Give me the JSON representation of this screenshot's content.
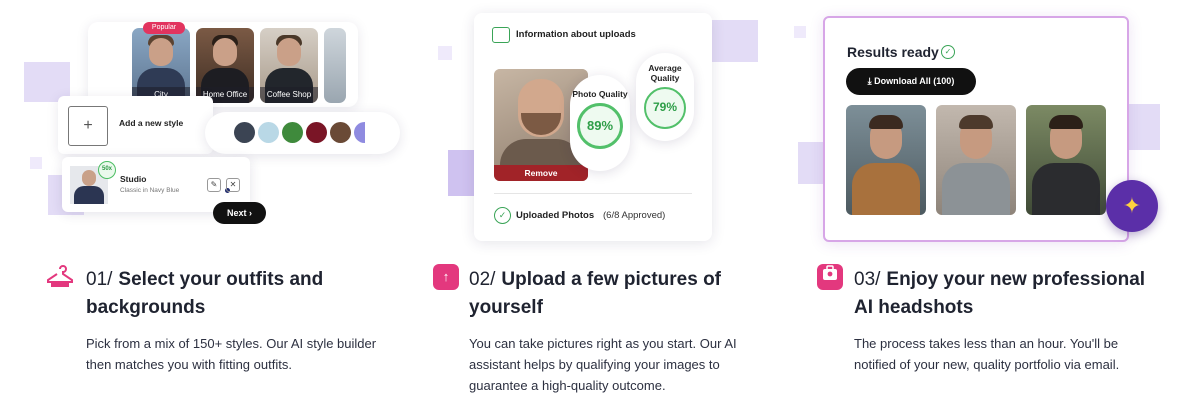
{
  "columns": [
    {
      "step_number": "01/",
      "title": "Select your outfits and backgrounds",
      "description": "Pick from a mix of 150+ styles. Our AI style builder then matches you with fitting outfits.",
      "icon": "hanger-icon",
      "mockup": {
        "popular_badge": "Popular",
        "styles": [
          "City",
          "Home Office",
          "Coffee Shop"
        ],
        "add_style_label": "Add a new style",
        "add_glyph": "+",
        "swatch_colors": [
          "#3b4453",
          "#b9d8e6",
          "#3f8a3c",
          "#7a1526",
          "#6a4a36",
          "#8f8be0"
        ],
        "selected_style": {
          "title": "Studio",
          "subtitle": "Classic in Navy Blue",
          "badge": "50x"
        },
        "next_button": "Next"
      }
    },
    {
      "step_number": "02/",
      "title": "Upload a few pictures of yourself",
      "description": "You can take pictures right as you start. Our AI assistant helps by qualifying your images to guarantee a high-quality outcome.",
      "icon": "upload-icon",
      "mockup": {
        "info_title": "Information about uploads",
        "remove_label": "Remove",
        "photo_quality_label": "Photo Quality",
        "photo_quality_value": "89%",
        "average_quality_label": "Average Quality",
        "average_quality_value": "79%",
        "uploaded_label": "Uploaded Photos",
        "uploaded_count": "(6/8 Approved)"
      }
    },
    {
      "step_number": "03/",
      "title": "Enjoy your new professional AI headshots",
      "description": "The process takes less than an hour. You'll be notified of your new, quality portfolio via email.",
      "icon": "portfolio-icon",
      "mockup": {
        "results_title": "Results ready",
        "download_button": "Download All (100)"
      }
    }
  ],
  "colors": {
    "accent": "#e3387e",
    "success": "#3aa457",
    "lavender": "#e3dcf6",
    "dark_button": "#111111"
  }
}
